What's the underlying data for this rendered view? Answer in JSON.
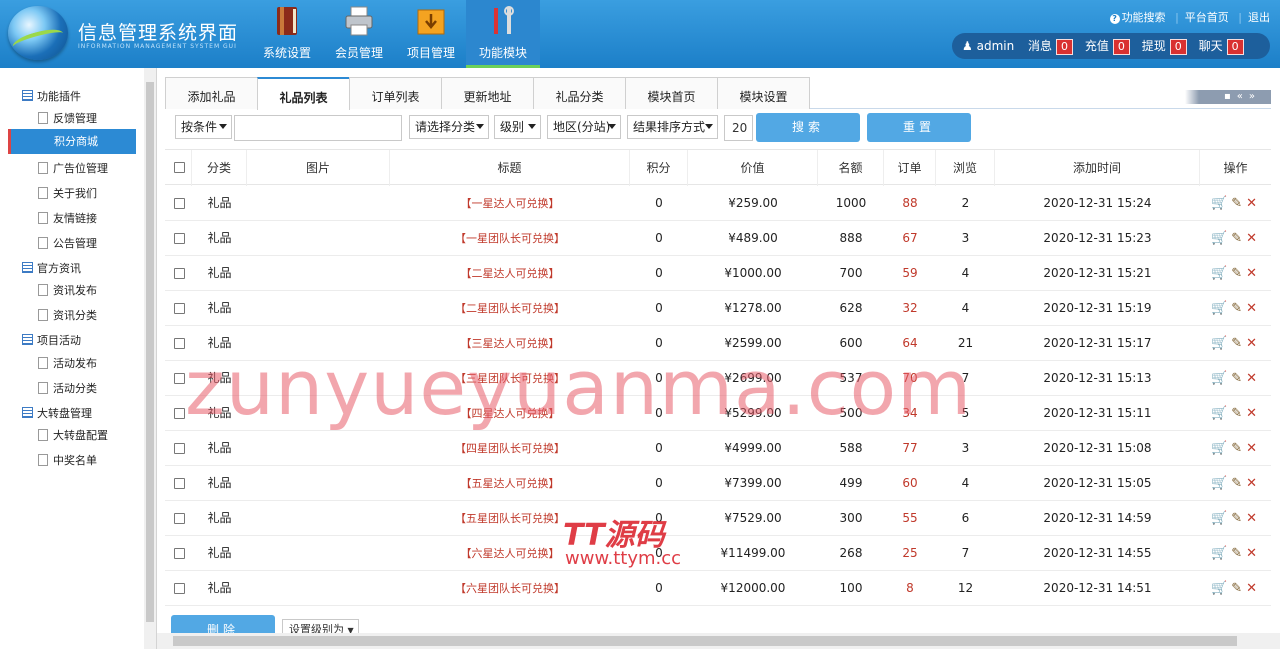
{
  "header": {
    "app_title": "信息管理系统界面",
    "app_subtitle": "INFORMATION MANAGEMENT SYSTEM GUI",
    "nav": [
      {
        "label": "系统设置",
        "icon": "book-icon"
      },
      {
        "label": "会员管理",
        "icon": "printer-icon"
      },
      {
        "label": "项目管理",
        "icon": "folder-download-icon"
      },
      {
        "label": "功能模块",
        "icon": "tools-icon",
        "active": true
      }
    ],
    "links": {
      "search": "功能搜索",
      "home": "平台首页",
      "logout": "退出"
    },
    "user": {
      "name": "admin",
      "counters": [
        {
          "label": "消息",
          "count": "0"
        },
        {
          "label": "充值",
          "count": "0"
        },
        {
          "label": "提现",
          "count": "0"
        },
        {
          "label": "聊天",
          "count": "0"
        }
      ]
    }
  },
  "sidebar": {
    "groups": [
      {
        "label": "功能插件",
        "items": [
          "反馈管理",
          "积分商城",
          "广告位管理",
          "关于我们",
          "友情链接",
          "公告管理"
        ]
      },
      {
        "label": "官方资讯",
        "items": [
          "资讯发布",
          "资讯分类"
        ]
      },
      {
        "label": "项目活动",
        "items": [
          "活动发布",
          "活动分类"
        ]
      },
      {
        "label": "大转盘管理",
        "items": [
          "大转盘配置",
          "中奖名单"
        ]
      }
    ],
    "active_item": "积分商城"
  },
  "tabs": [
    "添加礼品",
    "礼品列表",
    "订单列表",
    "更新地址",
    "礼品分类",
    "模块首页",
    "模块设置"
  ],
  "active_tab": "礼品列表",
  "filters": {
    "condition": "按条件",
    "keyword": "",
    "category": "请选择分类",
    "level": "级别",
    "region": "地区(分站)",
    "sort": "结果排序方式",
    "page_size": "20",
    "search_button": "搜索",
    "reset_button": "重置"
  },
  "table": {
    "headers": [
      "分类",
      "图片",
      "标题",
      "积分",
      "价值",
      "名额",
      "订单",
      "浏览",
      "添加时间",
      "操作"
    ],
    "rows": [
      {
        "category": "礼品",
        "title": "【一星达人可兑换】",
        "points": "0",
        "value": "¥259.00",
        "quota": "1000",
        "orders": "88",
        "views": "2",
        "time": "2020-12-31 15:24"
      },
      {
        "category": "礼品",
        "title": "【一星团队长可兑换】",
        "points": "0",
        "value": "¥489.00",
        "quota": "888",
        "orders": "67",
        "views": "3",
        "time": "2020-12-31 15:23"
      },
      {
        "category": "礼品",
        "title": "【二星达人可兑换】",
        "points": "0",
        "value": "¥1000.00",
        "quota": "700",
        "orders": "59",
        "views": "4",
        "time": "2020-12-31 15:21"
      },
      {
        "category": "礼品",
        "title": "【二星团队长可兑换】",
        "points": "0",
        "value": "¥1278.00",
        "quota": "628",
        "orders": "32",
        "views": "4",
        "time": "2020-12-31 15:19"
      },
      {
        "category": "礼品",
        "title": "【三星达人可兑换】",
        "points": "0",
        "value": "¥2599.00",
        "quota": "600",
        "orders": "64",
        "views": "21",
        "time": "2020-12-31 15:17"
      },
      {
        "category": "礼品",
        "title": "【三星团队长可兑换】",
        "points": "0",
        "value": "¥2699.00",
        "quota": "537",
        "orders": "70",
        "views": "7",
        "time": "2020-12-31 15:13"
      },
      {
        "category": "礼品",
        "title": "【四星达人可兑换】",
        "points": "0",
        "value": "¥5299.00",
        "quota": "500",
        "orders": "34",
        "views": "5",
        "time": "2020-12-31 15:11"
      },
      {
        "category": "礼品",
        "title": "【四星团队长可兑换】",
        "points": "0",
        "value": "¥4999.00",
        "quota": "588",
        "orders": "77",
        "views": "3",
        "time": "2020-12-31 15:08"
      },
      {
        "category": "礼品",
        "title": "【五星达人可兑换】",
        "points": "0",
        "value": "¥7399.00",
        "quota": "499",
        "orders": "60",
        "views": "4",
        "time": "2020-12-31 15:05"
      },
      {
        "category": "礼品",
        "title": "【五星团队长可兑换】",
        "points": "0",
        "value": "¥7529.00",
        "quota": "300",
        "orders": "55",
        "views": "6",
        "time": "2020-12-31 14:59"
      },
      {
        "category": "礼品",
        "title": "【六星达人可兑换】",
        "points": "0",
        "value": "¥11499.00",
        "quota": "268",
        "orders": "25",
        "views": "7",
        "time": "2020-12-31 14:55"
      },
      {
        "category": "礼品",
        "title": "【六星团队长可兑换】",
        "points": "0",
        "value": "¥12000.00",
        "quota": "100",
        "orders": "8",
        "views": "12",
        "time": "2020-12-31 14:51"
      }
    ]
  },
  "bottom": {
    "delete_button": "删除",
    "level_select": "设置级别为"
  },
  "watermarks": {
    "main": "zunyueyuanma.com",
    "brand": "TT源码",
    "url": "www.ttym.cc"
  },
  "colors": {
    "header": "#1c7fc8",
    "accent": "#52a8e4",
    "red": "#c0392b"
  }
}
